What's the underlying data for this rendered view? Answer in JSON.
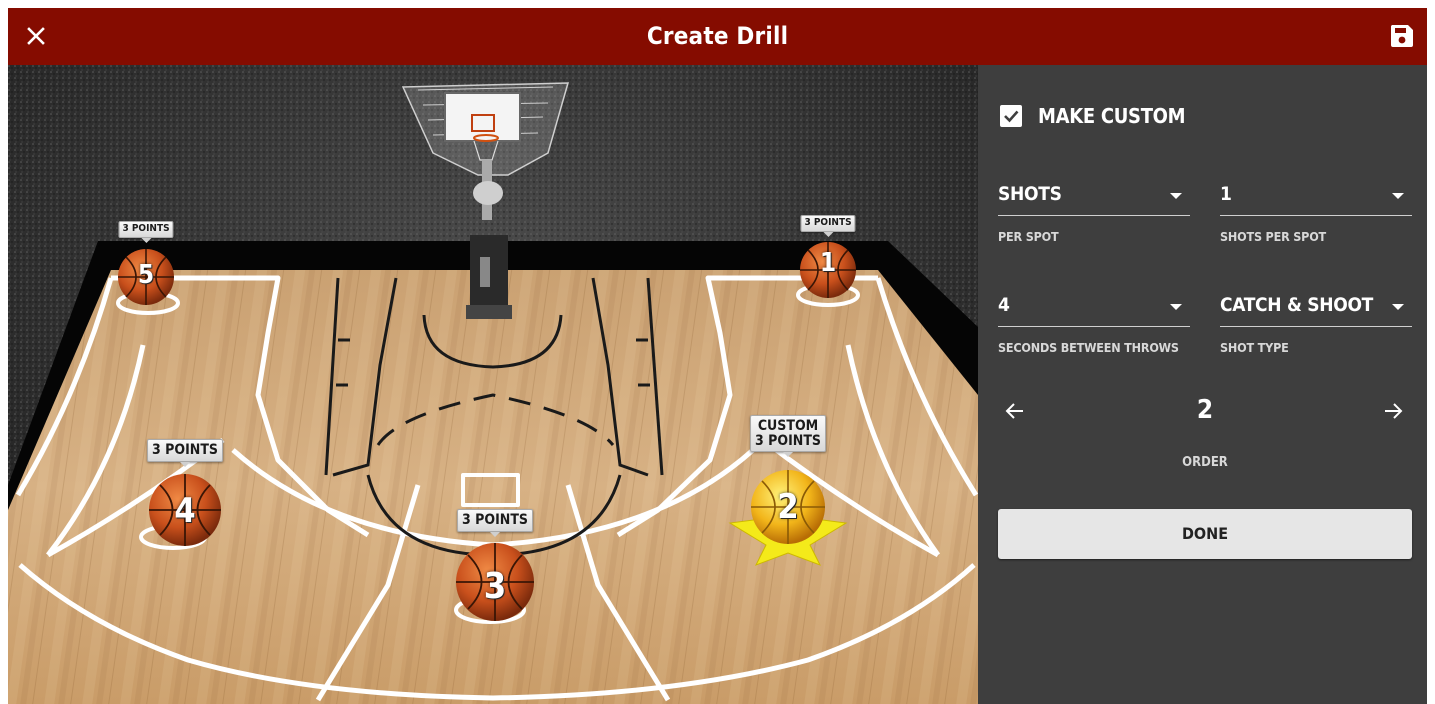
{
  "header": {
    "title": "Create Drill",
    "close_icon": "close-icon",
    "save_icon": "floppy-disk-icon",
    "background": "#850c00"
  },
  "court": {
    "spots": [
      {
        "number": "5",
        "label": "3 POINTS",
        "selected": false
      },
      {
        "number": "1",
        "label": "3 POINTS",
        "selected": false
      },
      {
        "number": "4",
        "label": "3 POINTS",
        "selected": false
      },
      {
        "number": "3",
        "label": "3 POINTS",
        "selected": false
      },
      {
        "number": "2",
        "label_line1": "CUSTOM",
        "label_line2": "3 POINTS",
        "selected": true
      }
    ]
  },
  "panel": {
    "make_custom_label": "MAKE CUSTOM",
    "make_custom_checked": true,
    "shots_value": "SHOTS",
    "shots_caption": "PER SPOT",
    "shots_per_spot_value": "1",
    "shots_per_spot_caption": "SHOTS PER SPOT",
    "seconds_value": "4",
    "seconds_caption": "SECONDS BETWEEN THROWS",
    "shot_type_value": "CATCH & SHOOT",
    "shot_type_caption": "SHOT TYPE",
    "order_value": "2",
    "order_caption": "ORDER",
    "prev_icon": "arrow-left-icon",
    "next_icon": "arrow-right-icon",
    "done_label": "DONE",
    "background": "#3e3e3e"
  }
}
